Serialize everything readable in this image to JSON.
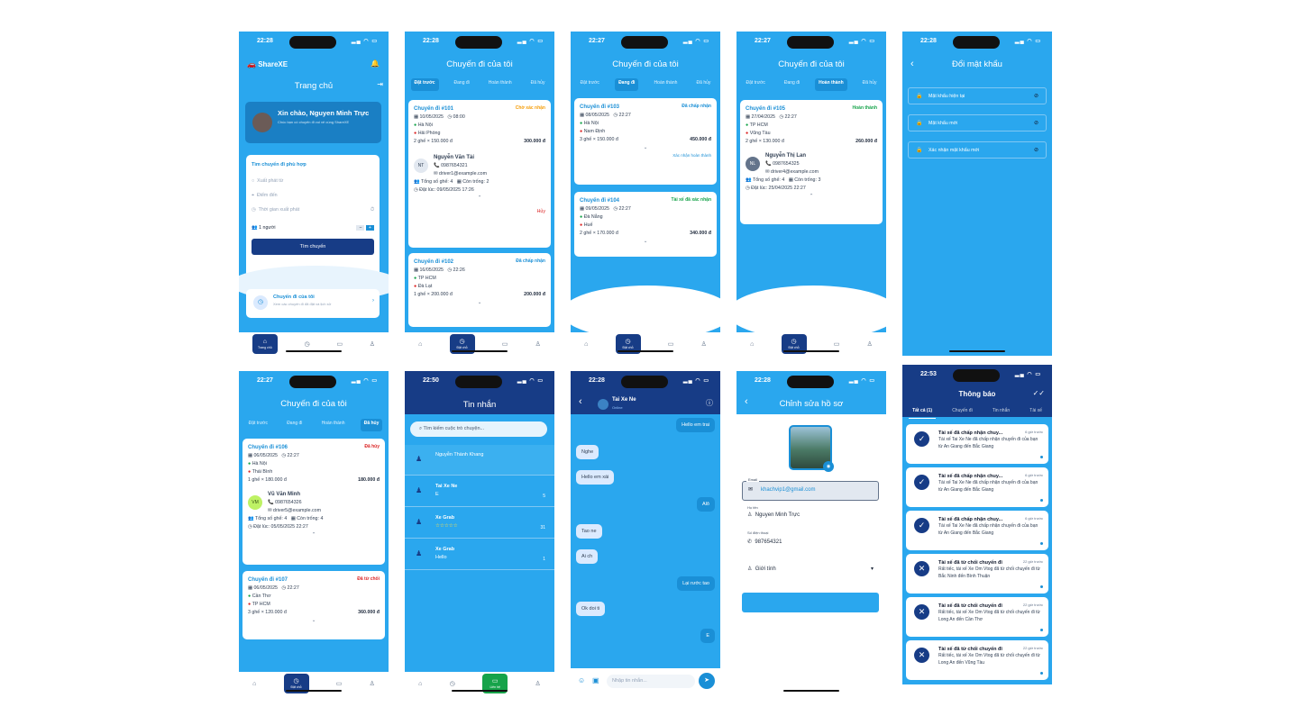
{
  "p1": {
    "time": "22:28",
    "app": "ShareXE",
    "title": "Trang chủ",
    "greet": "Xin chào, Nguyen Minh Trực",
    "greet_sub": "Chúc bạn có chuyến đi vui vẻ cùng ShareXE",
    "search_title": "Tìm chuyến đi phù hợp",
    "from": "Xuất phát từ",
    "to": "Điểm đến",
    "date": "Thời gian xuất phát",
    "pax": "1 người",
    "btn": "Tìm chuyến",
    "mytrip": "Chuyến đi của tôi",
    "mytrip_sub": "Xem các chuyến đi đã đặt và lịch sử",
    "nav_home": "Trang chủ"
  },
  "p2": {
    "time": "22:28",
    "title": "Chuyến đi của tôi",
    "tabs": [
      "Đặt trước",
      "Đang đi",
      "Hoàn thành",
      "Đã hủy"
    ],
    "c1": {
      "id": "Chuyến đi #101",
      "status": "Chờ xác nhận",
      "date": "10/05/2025",
      "time": "08:00",
      "from": "Hà Nội",
      "to": "Hải Phòng",
      "seats": "2 ghế × 150.000 đ",
      "price": "300.000 đ",
      "driver_init": "NT",
      "driver": "Nguyễn Văn Tài",
      "phone": "0987654321",
      "email": "driver1@example.com",
      "total": "Tổng số ghế: 4",
      "empty": "Còn trống: 2",
      "booked": "Đặt lúc: 09/05/2025 17:26",
      "cancel": "Hủy"
    },
    "c2": {
      "id": "Chuyến đi #102",
      "status": "Đã chấp nhận",
      "date": "16/05/2025",
      "time": "22:26",
      "from": "TP HCM",
      "to": "Đà Lạt",
      "seats": "1 ghế × 200.000 đ",
      "price": "200.000 đ"
    },
    "nav_trip": "Đặt chỗ"
  },
  "p3": {
    "time": "22:27",
    "title": "Chuyến đi của tôi",
    "tabs": [
      "Đặt trước",
      "Đang đi",
      "Hoàn thành",
      "Đã hủy"
    ],
    "c1": {
      "id": "Chuyến đi #103",
      "status": "Đã chấp nhận",
      "date": "08/05/2025",
      "time": "22:27",
      "from": "Hà Nội",
      "to": "Nam Định",
      "seats": "3 ghế × 150.000 đ",
      "price": "450.000 đ",
      "confirm": "Xác nhận hoàn thành"
    },
    "c2": {
      "id": "Chuyến đi #104",
      "status": "Tài xế đã xác nhận",
      "date": "09/05/2025",
      "time": "22:27",
      "from": "Đà Nẵng",
      "to": "Huế",
      "seats": "2 ghế × 170.000 đ",
      "price": "340.000 đ"
    },
    "nav_trip": "Đặt chỗ"
  },
  "p4": {
    "time": "22:27",
    "title": "Chuyến đi của tôi",
    "tabs": [
      "Đặt trước",
      "Đang đi",
      "Hoàn thành",
      "Đã hủy"
    ],
    "c1": {
      "id": "Chuyến đi #105",
      "status": "Hoàn thành",
      "date": "27/04/2025",
      "time": "22:27",
      "from": "TP HCM",
      "to": "Vũng Tàu",
      "seats": "2 ghế × 130.000 đ",
      "price": "260.000 đ",
      "driver_init": "NL",
      "driver": "Nguyễn Thị Lan",
      "phone": "0987654325",
      "email": "driver4@example.com",
      "total": "Tổng số ghế: 4",
      "empty": "Còn trống: 3",
      "booked": "Đặt lúc: 25/04/2025 22:27"
    },
    "nav_trip": "Đặt chỗ"
  },
  "p5": {
    "time": "22:28",
    "title": "Đổi mật khẩu",
    "f1": "Mật khẩu hiện tại",
    "f2": "Mật khẩu mới",
    "f3": "Xác nhận mật khẩu mới"
  },
  "p6": {
    "time": "22:27",
    "title": "Chuyến đi của tôi",
    "tabs": [
      "Đặt trước",
      "Đang đi",
      "Hoàn thành",
      "Đã hủy"
    ],
    "c1": {
      "id": "Chuyến đi #106",
      "status": "Đã hủy",
      "date": "06/05/2025",
      "time": "22:27",
      "from": "Hà Nội",
      "to": "Thái Bình",
      "seats": "1 ghế × 180.000 đ",
      "price": "180.000 đ",
      "driver_init": "VM",
      "driver": "Vũ Văn Minh",
      "phone": "0987654326",
      "email": "driver5@example.com",
      "total": "Tổng số ghế: 4",
      "empty": "Còn trống: 4",
      "booked": "Đặt lúc: 05/05/2025 22:27"
    },
    "c2": {
      "id": "Chuyến đi #107",
      "status": "Đã từ chối",
      "date": "06/05/2025",
      "time": "22:27",
      "from": "Cần Thơ",
      "to": "TP HCM",
      "seats": "3 ghế × 120.000 đ",
      "price": "360.000 đ"
    },
    "nav_trip": "Đặt chỗ"
  },
  "p7": {
    "time": "22:50",
    "title": "Tin nhắn",
    "search": "Tìm kiếm cuộc trò chuyện...",
    "chats": [
      {
        "name": "Nguyễn Thành Khang",
        "last": "",
        "badge": ""
      },
      {
        "name": "Tai Xe Ne",
        "last": "E",
        "badge": "5"
      },
      {
        "name": "Xe Grab",
        "last": "☆☆☆☆☆",
        "badge": "31"
      },
      {
        "name": "Xe Grab",
        "last": "Hello",
        "badge": "1"
      }
    ],
    "nav_chat": "Liên hệ"
  },
  "p8": {
    "time": "22:28",
    "name": "Tai Xe Ne",
    "sub": "Online",
    "msgs": [
      "Hello em trai",
      "Nghe",
      "Hello em xái",
      "Alô",
      "Tao ne",
      "Ai ch",
      "Lại rước tao",
      "Ok doi ti",
      "E"
    ],
    "placeholder": "Nhập tin nhắn..."
  },
  "p9": {
    "time": "22:28",
    "title": "Chỉnh sửa hồ sơ",
    "email_label": "Email",
    "email": "khachvip1@gmail.com",
    "name_label": "Họ tên",
    "name": "Nguyen Minh Trực",
    "phone_label": "Số điện thoại",
    "phone": "987654321",
    "gender": "Giới tính"
  },
  "p10": {
    "time": "22:53",
    "title": "Thông báo",
    "tabs": [
      "Tất cả (1)",
      "Chuyến đi",
      "Tin nhắn",
      "Tài xế"
    ],
    "items": [
      {
        "t": "Tài xế đã chấp nhận chuy...",
        "d": "Tài xế Tai Xe Ne đã chấp nhận chuyến đi của bạn từ An Giang đến Bắc Giang",
        "w": "6 giờ trước",
        "icon": "✓"
      },
      {
        "t": "Tài xế đã chấp nhận chuy...",
        "d": "Tài xế Tai Xe Ne đã chấp nhận chuyến đi của bạn từ An Giang đến Bắc Giang",
        "w": "6 giờ trước",
        "icon": "✓"
      },
      {
        "t": "Tài xế đã chấp nhận chuy...",
        "d": "Tài xế Tai Xe Ne đã chấp nhận chuyến đi của bạn từ An Giang đến Bắc Giang",
        "w": "6 giờ trước",
        "icon": "✓"
      },
      {
        "t": "Tài xế đã từ chối chuyến đi",
        "d": "Rất tiếc, tài xế Xe Om Vtog đã từ chối chuyến đi từ Bắc Ninh đến Bình Thuận",
        "w": "22 giờ trước",
        "icon": "✕"
      },
      {
        "t": "Tài xế đã từ chối chuyến đi",
        "d": "Rất tiếc, tài xế Xe Om Vtog đã từ chối chuyến đi từ Long An đến Cần Thơ",
        "w": "22 giờ trước",
        "icon": "✕"
      },
      {
        "t": "Tài xế đã từ chối chuyến đi",
        "d": "Rất tiếc, tài xế Xe Om Vtog đã từ chối chuyến đi từ Long An đến Vũng Tàu",
        "w": "22 giờ trước",
        "icon": "✕"
      }
    ]
  }
}
